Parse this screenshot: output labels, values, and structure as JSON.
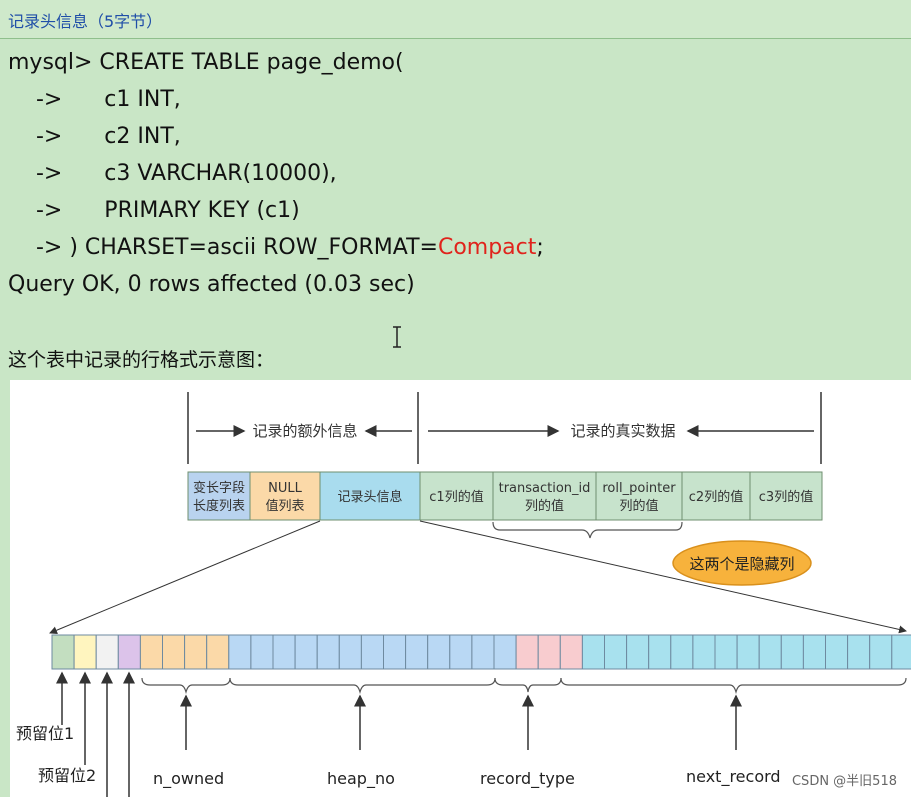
{
  "header": {
    "title": "记录头信息（5字节）"
  },
  "code": {
    "lines": [
      "mysql> CREATE TABLE page_demo(",
      "    ->      c1 INT,",
      "    ->      c2 INT,",
      "    ->      c3 VARCHAR(10000),",
      "    ->      PRIMARY KEY (c1)",
      "    -> ) CHARSET=ascii ROW_FORMAT=",
      "Query OK, 0 rows affected (0.03 sec)"
    ],
    "highlight": "Compact",
    "line6_tail": ";"
  },
  "caption": "这个表中记录的行格式示意图：",
  "figure": {
    "extra_info_label": "记录的额外信息",
    "real_data_label": "记录的真实数据",
    "segments": [
      {
        "lines": [
          "变长字段",
          "长度列表"
        ],
        "color": "#b9d3ef"
      },
      {
        "lines": [
          "NULL",
          "值列表"
        ],
        "color": "#fbd9a8"
      },
      {
        "lines": [
          "记录头信息"
        ],
        "color": "#a9dcee"
      },
      {
        "lines": [
          "c1列的值"
        ],
        "color": "#c7e3cc"
      },
      {
        "lines": [
          "transaction_id",
          "列的值"
        ],
        "color": "#c7e3cc"
      },
      {
        "lines": [
          "roll_pointer",
          "列的值"
        ],
        "color": "#c7e3cc"
      },
      {
        "lines": [
          "c2列的值"
        ],
        "color": "#c7e3cc"
      },
      {
        "lines": [
          "c3列的值"
        ],
        "color": "#c7e3cc"
      }
    ],
    "hidden_callout": "这两个是隐藏列",
    "bit_colors": {
      "reserved1": "#c3dec0",
      "reserved2": "#fff5bf",
      "deleted": "#f2f2f2",
      "min_rec": "#dcc3ea",
      "n_owned": "#fbd9a8",
      "heap_no": "#b9d8f4",
      "record_type": "#f8cccf",
      "next_record": "#a8e1ee"
    },
    "labels": {
      "reserved1": "预留位1",
      "reserved2": "预留位2",
      "n_owned": "n_owned",
      "heap_no": "heap_no",
      "record_type": "record_type",
      "next_record": "next_record"
    }
  },
  "watermark": "CSDN @半旧518"
}
